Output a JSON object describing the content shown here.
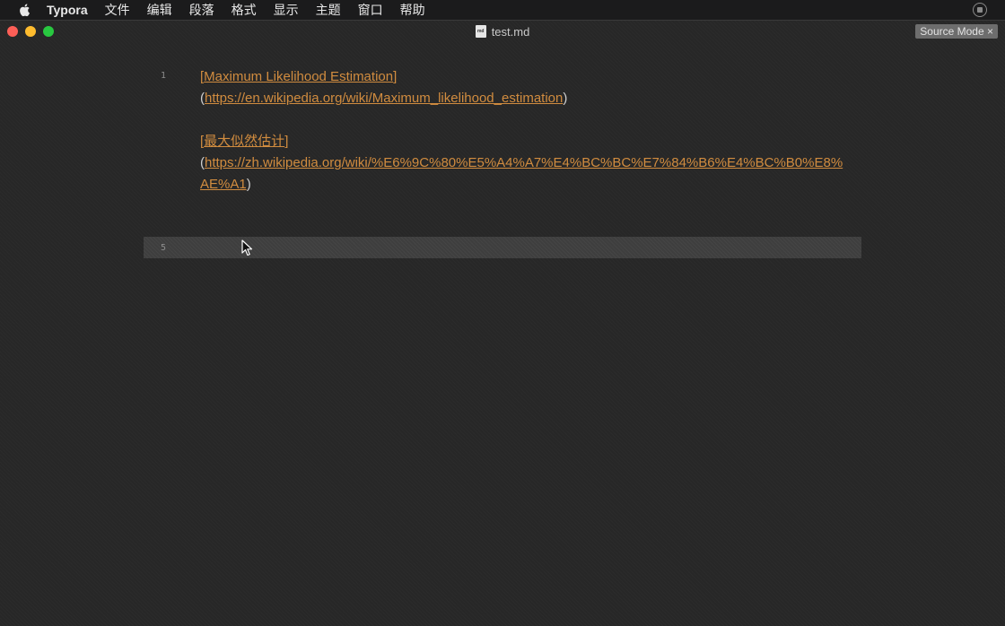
{
  "menubar": {
    "app_name": "Typora",
    "items": [
      "文件",
      "编辑",
      "段落",
      "格式",
      "显示",
      "主题",
      "窗口",
      "帮助"
    ]
  },
  "window": {
    "title": "test.md",
    "file_icon_label": "md",
    "badge": "Source Mode ×"
  },
  "editor": {
    "line1_number": "1",
    "line5_number": "5",
    "link1": {
      "open_bracket": "[",
      "text": "Maximum Likelihood Estimation",
      "close_bracket": "]",
      "open_paren": "(",
      "url": "https://en.wikipedia.org/wiki/Maximum_likelihood_estimation",
      "close_paren": ")"
    },
    "link2": {
      "open_bracket": "[",
      "text": "最大似然估计",
      "close_bracket": "]",
      "open_paren": "(",
      "url": "https://zh.wikipedia.org/wiki/%E6%9C%80%E5%A4%A7%E4%BC%BC%E7%84%B6%E4%BC%B0%E8%AE%A1",
      "close_paren": ")"
    }
  },
  "colors": {
    "link": "#d18c3f",
    "background": "#272727",
    "active_line": "#3e3e3e"
  }
}
